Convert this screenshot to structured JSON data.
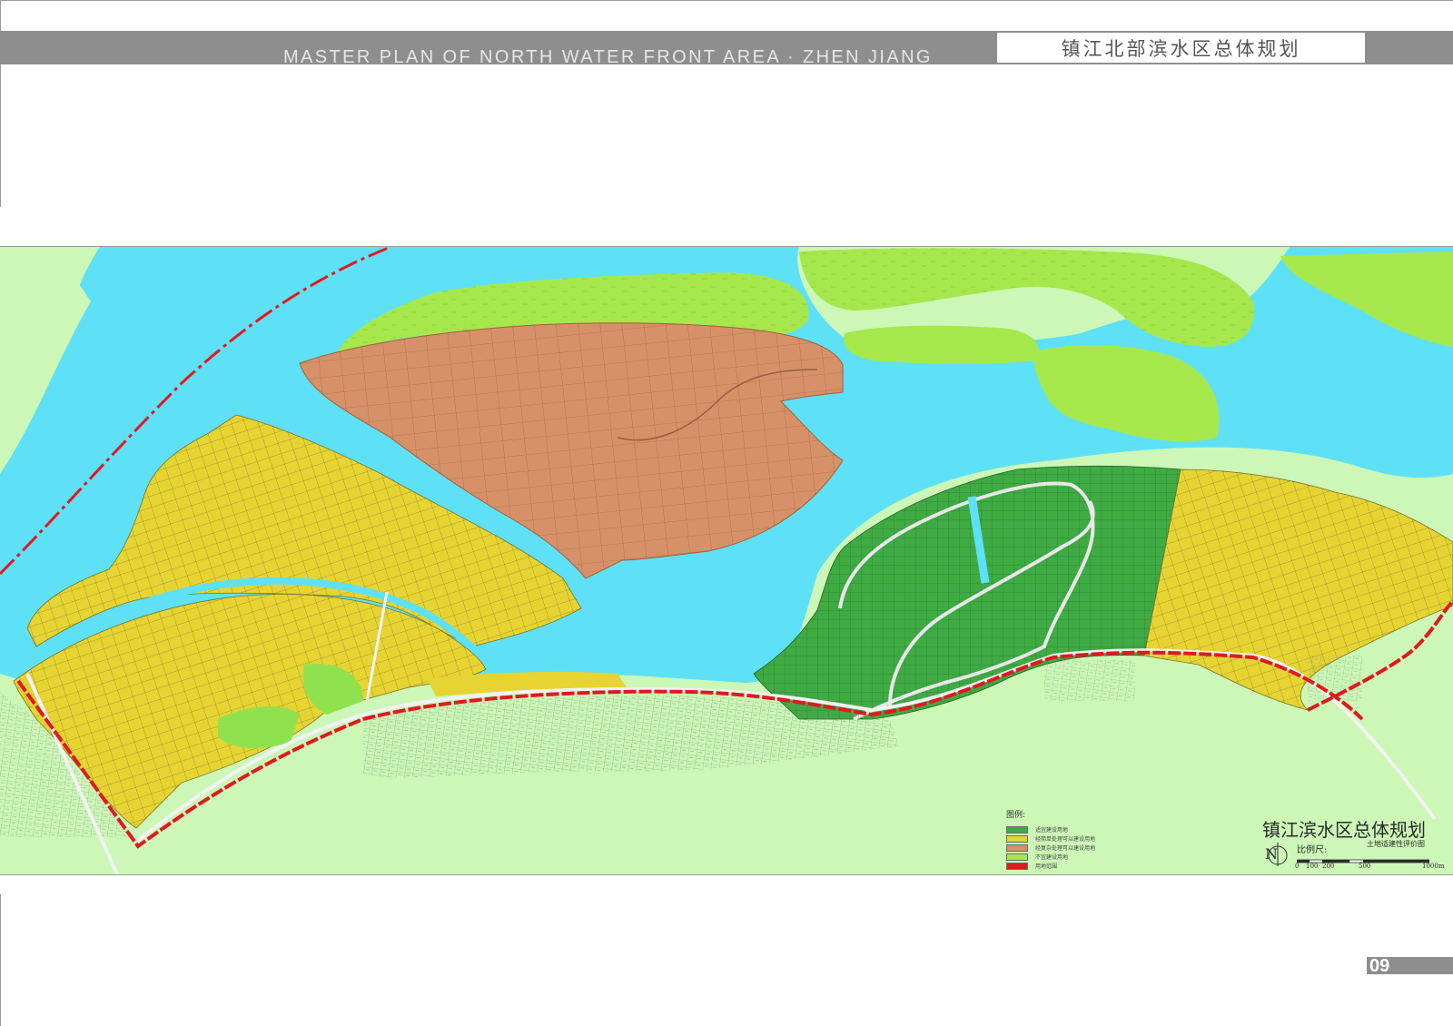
{
  "header": {
    "title_en": "MASTER PLAN OF NORTH WATER FRONT AREA · ZHEN  JIANG",
    "title_cn": "镇江北部滨水区总体规划"
  },
  "map": {
    "title": "镇江滨水区总体规划",
    "subtitle": "土地适建性评价图",
    "north_label": "N",
    "scale_label": "比例尺:",
    "scale_ticks": [
      "0",
      "100",
      "200",
      "500",
      "1000m"
    ],
    "colors": {
      "water": "#5ee1f7",
      "land_bg": "#ccf7b7",
      "island_green": "#a6e84c",
      "orange": "#d69168",
      "yellow": "#e6d433",
      "dark_green": "#3fab43",
      "light_green_patch": "#8fe24e",
      "boundary": "#e0191f"
    }
  },
  "legend": {
    "title": "图例:",
    "items": [
      {
        "label": "适宜建设用地",
        "color": "#3fab43"
      },
      {
        "label": "经简单处理可以建设用地",
        "color": "#e6d433"
      },
      {
        "label": "经复杂处理可以建设用地",
        "color": "#d69168"
      },
      {
        "label": "不宜建设用地",
        "color": "#a6e84c"
      },
      {
        "label": "用地范围",
        "color": "#e0191f"
      }
    ]
  },
  "page": {
    "number": "09"
  }
}
